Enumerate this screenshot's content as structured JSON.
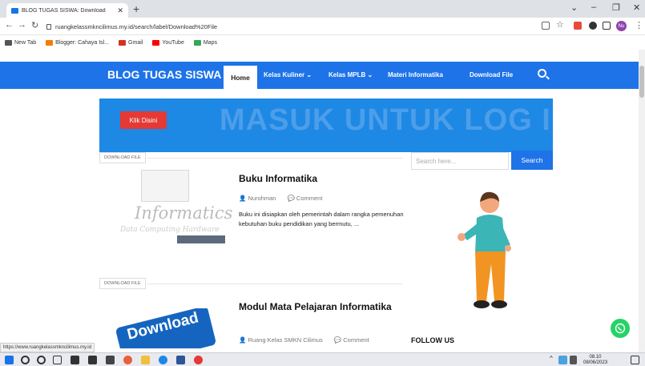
{
  "browser": {
    "tab_title": "BLOG TUGAS SISWA: Download",
    "url": "ruangkelassmkncilimus.my.id/search/label/Download%20File",
    "bookmarks": [
      {
        "label": "New Tab",
        "color": "#555555"
      },
      {
        "label": "Blogger: Cahaya Isl...",
        "color": "#f57c00"
      },
      {
        "label": "Gmail",
        "color": "#d93025"
      },
      {
        "label": "YouTube",
        "color": "#ff0000"
      },
      {
        "label": "Maps",
        "color": "#34a853"
      }
    ],
    "profile_initials": "Nu",
    "status_url": "https://www.ruangkelassmkncilimus.my.id"
  },
  "site": {
    "brand": "BLOG TUGAS SISWA",
    "nav": {
      "home": "Home",
      "kuliner": "Kelas Kuliner ⌄",
      "mplb": "Kelas MPLB ⌄",
      "materi": "Materi Informatika",
      "download": "Download File"
    },
    "banner": {
      "button": "Klik Disini",
      "title": "MASUK UNTUK LOG IN"
    }
  },
  "posts": [
    {
      "label": "DOWNLOAD FILE",
      "title": "Buku Informatika",
      "author": "Nurohman",
      "comment": "Comment",
      "excerpt": "Buku ini disiapkan oleh pemerintah dalam rangka pemenuhan kebutuhan buku pendidikan yang bermutu, ...",
      "thumb_word": "Informatics",
      "thumb_sub": "Data Computing Hardware"
    },
    {
      "label": "DOWNLOAD FILE",
      "title": "Modul Mata Pelajaran Informatika",
      "author": "Ruang Kelas SMKN Cilimus",
      "comment": "Comment",
      "thumb_word": "Download"
    }
  ],
  "sidebar": {
    "search_placeholder": "Search here...",
    "search_button": "Search",
    "follow_us": "FOLLOW US"
  },
  "taskbar": {
    "time": "08.10",
    "date": "08/06/2023"
  },
  "colors": {
    "brand_blue": "#1e73e8",
    "banner_blue": "#1e88e5",
    "button_red": "#e53935",
    "whatsapp_green": "#25d366"
  }
}
